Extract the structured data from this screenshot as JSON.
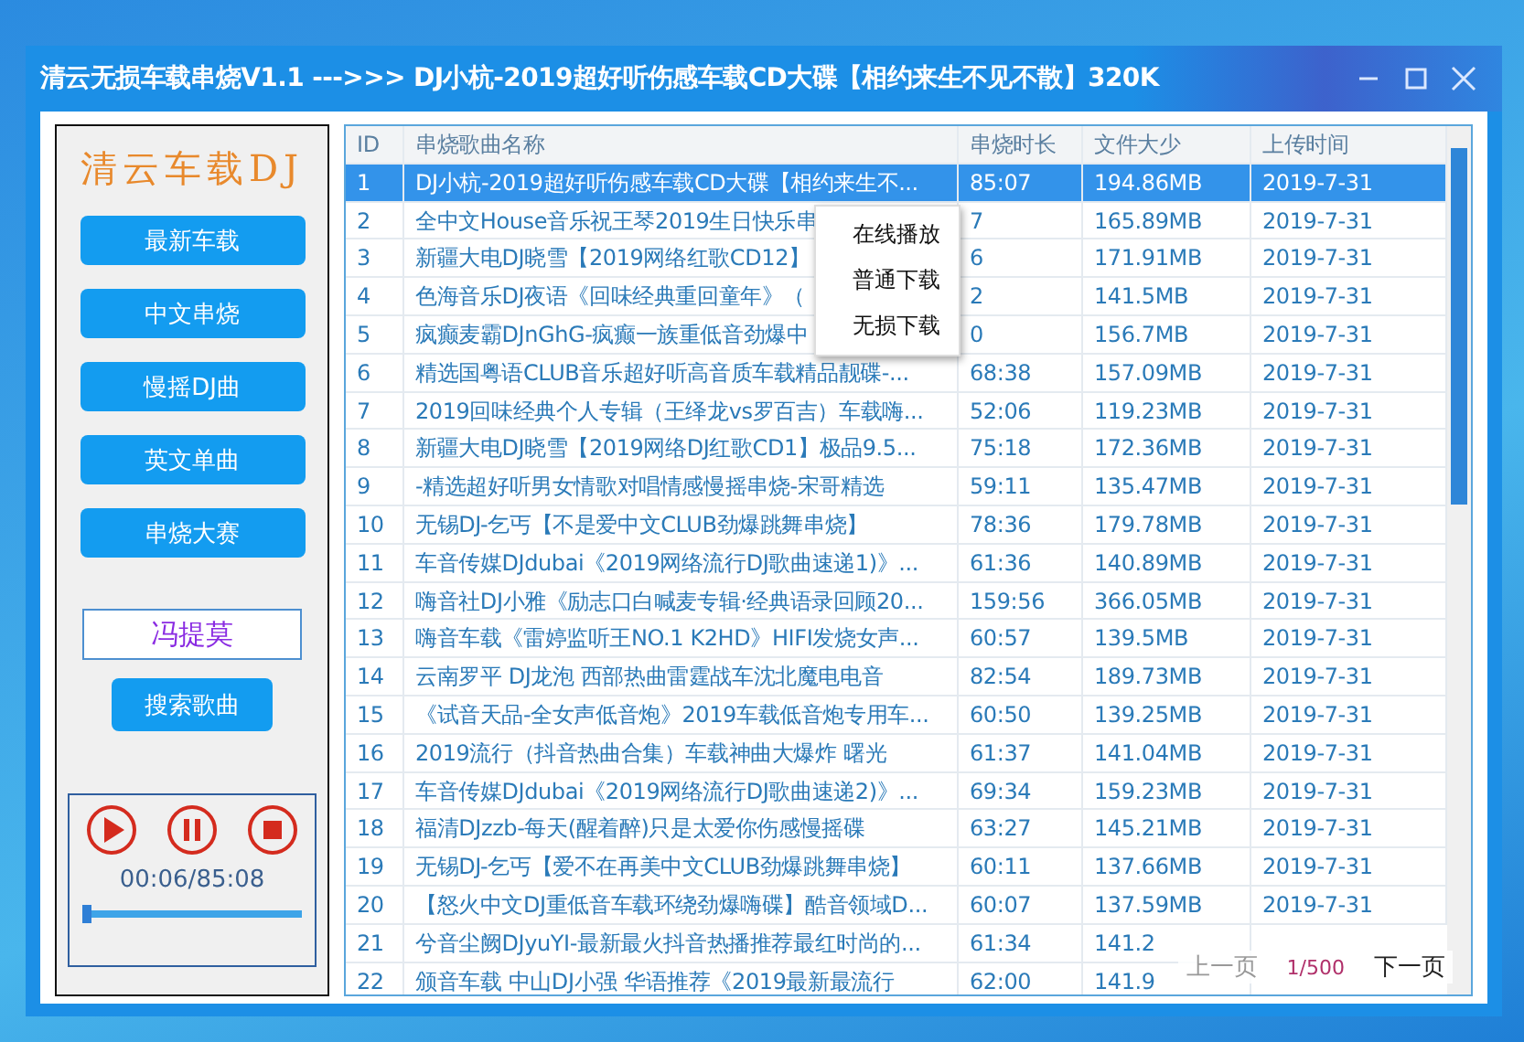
{
  "window": {
    "title": "清云无损车载串烧V1.1 --->>> DJ小杭-2019超好听伤感车载CD大碟【相约来生不见不散】320K"
  },
  "sidebar": {
    "logo": "清云车载DJ",
    "categories": [
      {
        "label": "最新车载"
      },
      {
        "label": "中文串烧"
      },
      {
        "label": "慢摇DJ曲"
      },
      {
        "label": "英文单曲"
      },
      {
        "label": "串烧大赛"
      }
    ],
    "search": {
      "value": "冯提莫",
      "button": "搜索歌曲"
    }
  },
  "player": {
    "time": "00:06/85:08",
    "level": 0.04
  },
  "table": {
    "columns": [
      "ID",
      "串烧歌曲名称",
      "串烧时长",
      "文件大少",
      "上传时间"
    ],
    "rows": [
      {
        "id": "1",
        "name": "DJ小杭-2019超好听伤感车载CD大碟【相约来生不...",
        "duration": "85:07",
        "size": "194.86MB",
        "date": "2019-7-31",
        "selected": true
      },
      {
        "id": "2",
        "name": "全中文House音乐祝王琴2019生日快乐串",
        "duration": "7",
        "size": "165.89MB",
        "date": "2019-7-31",
        "selected": false
      },
      {
        "id": "3",
        "name": "新疆大电DJ晓雪【2019网络红歌CD12】",
        "duration": "6",
        "size": "171.91MB",
        "date": "2019-7-31",
        "selected": false
      },
      {
        "id": "4",
        "name": "色海音乐DJ夜语《回味经典重回童年》（",
        "duration": "2",
        "size": "141.5MB",
        "date": "2019-7-31",
        "selected": false
      },
      {
        "id": "5",
        "name": "疯癫麦霸DJnGhG-疯癫一族重低音劲爆中",
        "duration": "0",
        "size": "156.7MB",
        "date": "2019-7-31",
        "selected": false
      },
      {
        "id": "6",
        "name": "精选国粤语CLUB音乐超好听高音质车载精品靓碟-...",
        "duration": "68:38",
        "size": "157.09MB",
        "date": "2019-7-31",
        "selected": false
      },
      {
        "id": "7",
        "name": "2019回味经典个人专辑（王绎龙vs罗百吉）车载嗨...",
        "duration": "52:06",
        "size": "119.23MB",
        "date": "2019-7-31",
        "selected": false
      },
      {
        "id": "8",
        "name": "新疆大电DJ晓雪【2019网络DJ红歌CD1】极品9.5...",
        "duration": "75:18",
        "size": "172.36MB",
        "date": "2019-7-31",
        "selected": false
      },
      {
        "id": "9",
        "name": "-精选超好听男女情歌对唱情感慢摇串烧-宋哥精选",
        "duration": "59:11",
        "size": "135.47MB",
        "date": "2019-7-31",
        "selected": false
      },
      {
        "id": "10",
        "name": "无锡DJ-乞丐【不是爱中文CLUB劲爆跳舞串烧】",
        "duration": "78:36",
        "size": "179.78MB",
        "date": "2019-7-31",
        "selected": false
      },
      {
        "id": "11",
        "name": "车音传媒DJdubai《2019网络流行DJ歌曲速递1)》...",
        "duration": "61:36",
        "size": "140.89MB",
        "date": "2019-7-31",
        "selected": false
      },
      {
        "id": "12",
        "name": "嗨音社DJ小雅《励志口白喊麦专辑·经典语录回顾20...",
        "duration": "159:56",
        "size": "366.05MB",
        "date": "2019-7-31",
        "selected": false
      },
      {
        "id": "13",
        "name": "嗨音车载《雷婷监听王NO.1 K2HD》HIFI发烧女声...",
        "duration": "60:57",
        "size": "139.5MB",
        "date": "2019-7-31",
        "selected": false
      },
      {
        "id": "14",
        "name": "云南罗平 DJ龙泡 西部热曲雷霆战车沈北魔电电音",
        "duration": "82:54",
        "size": "189.73MB",
        "date": "2019-7-31",
        "selected": false
      },
      {
        "id": "15",
        "name": "《试音天品-全女声低音炮》2019车载低音炮专用车...",
        "duration": "60:50",
        "size": "139.25MB",
        "date": "2019-7-31",
        "selected": false
      },
      {
        "id": "16",
        "name": "2019流行（抖音热曲合集）车载神曲大爆炸 曙光",
        "duration": "61:37",
        "size": "141.04MB",
        "date": "2019-7-31",
        "selected": false
      },
      {
        "id": "17",
        "name": "车音传媒DJdubai《2019网络流行DJ歌曲速递2)》...",
        "duration": "69:34",
        "size": "159.23MB",
        "date": "2019-7-31",
        "selected": false
      },
      {
        "id": "18",
        "name": "福清DJzzb-每天(醒着醉)只是太爱你伤感慢摇碟",
        "duration": "63:27",
        "size": "145.21MB",
        "date": "2019-7-31",
        "selected": false
      },
      {
        "id": "19",
        "name": "无锡DJ-乞丐【爱不在再美中文CLUB劲爆跳舞串烧】",
        "duration": "60:11",
        "size": "137.66MB",
        "date": "2019-7-31",
        "selected": false
      },
      {
        "id": "20",
        "name": "【怒火中文DJ重低音车载环绕劲爆嗨碟】酷音领域D...",
        "duration": "60:07",
        "size": "137.59MB",
        "date": "2019-7-31",
        "selected": false
      },
      {
        "id": "21",
        "name": "兮音尘阙DJyuYI-最新最火抖音热播推荐最红时尚的...",
        "duration": "61:34",
        "size": "141.2",
        "selected": false
      },
      {
        "id": "22",
        "name": "颁音车载 中山DJ小强 华语推荐《2019最新最流行",
        "duration": "62:00",
        "size": "141.9",
        "selected": false
      }
    ]
  },
  "context_menu": {
    "items": [
      "在线播放",
      "普通下载",
      "无损下载"
    ]
  },
  "pager": {
    "prev": "上一页",
    "page": "1/500",
    "next": "下一页"
  }
}
